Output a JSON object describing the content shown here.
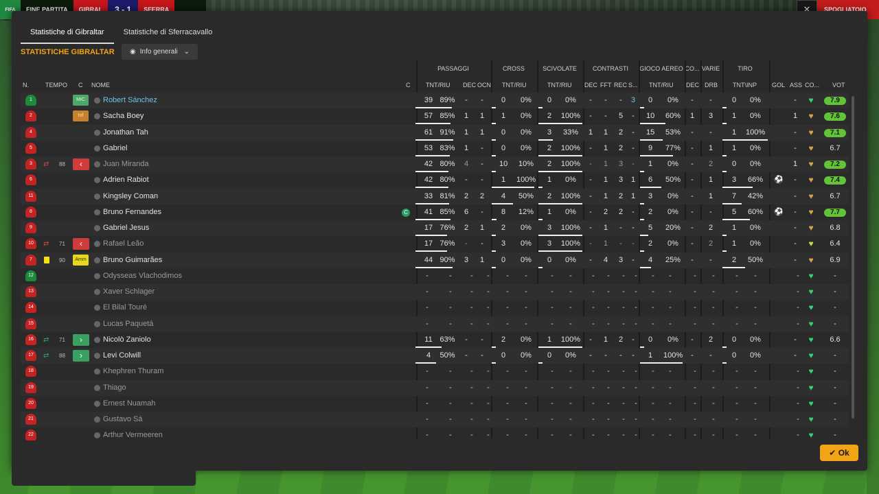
{
  "scorebar": {
    "phase": "FINE PARTITA",
    "home": "GIBRAL",
    "result": "3 - 1",
    "away": "SFERRA",
    "logo": "FIFA",
    "right_label": "SPOGLIATOIO"
  },
  "tabs": [
    {
      "label": "Statistiche di Gibraltar",
      "active": true
    },
    {
      "label": "Statistiche di Sferracavallo",
      "active": false
    }
  ],
  "title": "STATISTICHE GIBRALTAR",
  "dropdown": {
    "label": "Info generali",
    "icon": "eye-icon"
  },
  "group_headers": {
    "passaggi": "PASSAGGI",
    "cross": "CROSS",
    "scivolate": "SCIVOLATE",
    "contrasti": "CONTRASTI",
    "gioco_aereo": "GIOCO AEREO",
    "co": "CO...",
    "varie": "VARIE",
    "tiro": "TIRO"
  },
  "headers": {
    "n": "N.",
    "tempo": "TEMPO",
    "c": "C",
    "nome": "NOME",
    "cap": "C",
    "pass_tnt": "TNT/RIU",
    "pass_dec": "DEC",
    "pass_ocn": "OCN",
    "cross_tnt": "TNT/RIU",
    "sciv_tnt": "TNT/RIU",
    "con_dec": "DEC",
    "con_fft": "FFT",
    "con_rec": "REC",
    "con_s": "S...",
    "aer_tnt": "TNT/RIU",
    "co_dec": "DEC",
    "var_drb": "DRB",
    "tiro_tnt": "TNT\\INP",
    "gol": "GOL",
    "ass": "ASS",
    "co2": "CO...",
    "vot": "VOT"
  },
  "colors": {
    "accent": "#f2a417",
    "link": "#6fc3e6",
    "gk": "#1c8a3a",
    "outfield": "#c42323"
  },
  "players": [
    {
      "n": "1",
      "gk": true,
      "pos": "MIC",
      "pos_bg": "#4fa66a",
      "pos_fg": "#d9f5df",
      "name": "Robert Sánchez",
      "highlight": true,
      "sub": "",
      "swap": "",
      "mins": "",
      "card": false,
      "cap": false,
      "p": [
        "39",
        "89%",
        "-",
        "-"
      ],
      "pb": 0.89,
      "cr": [
        "0",
        "0%"
      ],
      "crb": 0,
      "sc": [
        "0",
        "0%"
      ],
      "scb": 0,
      "ct": [
        "-",
        "-",
        "-",
        "3"
      ],
      "ae": [
        "0",
        "0%"
      ],
      "aeb": 0,
      "co": "-",
      "drb": "-",
      "ti": [
        "0",
        "0%"
      ],
      "tib": 0,
      "gol": "",
      "ass": "-",
      "heart": "#35d07a",
      "vot": "7.9",
      "votbg": "#62c338"
    },
    {
      "n": "2",
      "gk": false,
      "pos": "Inf",
      "pos_bg": "#c8812f",
      "pos_fg": "#fbe2c0",
      "name": "Sacha Boey",
      "highlight": false,
      "sub": "",
      "swap": "",
      "mins": "",
      "card": false,
      "cap": false,
      "p": [
        "57",
        "85%",
        "1",
        "1"
      ],
      "pb": 0.85,
      "cr": [
        "1",
        "0%"
      ],
      "crb": 0,
      "sc": [
        "2",
        "100%"
      ],
      "scb": 1,
      "ct": [
        "-",
        "-",
        "5",
        "-"
      ],
      "ae": [
        "10",
        "60%"
      ],
      "aeb": 0.6,
      "co": "1",
      "drb": "3",
      "ti": [
        "1",
        "0%"
      ],
      "tib": 0,
      "gol": "",
      "ass": "1",
      "heart": "#d8a24a",
      "vot": "7.6",
      "votbg": "#62c338"
    },
    {
      "n": "4",
      "gk": false,
      "pos": "",
      "pos_bg": "",
      "pos_fg": "",
      "name": "Jonathan Tah",
      "highlight": false,
      "sub": "",
      "swap": "",
      "mins": "",
      "card": false,
      "cap": false,
      "p": [
        "61",
        "91%",
        "1",
        "1"
      ],
      "pb": 0.91,
      "cr": [
        "0",
        "0%"
      ],
      "crb": 0,
      "sc": [
        "3",
        "33%"
      ],
      "scb": 0.33,
      "ct": [
        "1",
        "1",
        "2",
        "-"
      ],
      "ae": [
        "15",
        "53%"
      ],
      "aeb": 0.53,
      "co": "-",
      "drb": "-",
      "ti": [
        "1",
        "100%"
      ],
      "tib": 1,
      "gol": "",
      "ass": "-",
      "heart": "#d8a24a",
      "vot": "7.1",
      "votbg": "#62c338"
    },
    {
      "n": "5",
      "gk": false,
      "pos": "",
      "pos_bg": "",
      "pos_fg": "",
      "name": "Gabriel",
      "highlight": false,
      "sub": "",
      "swap": "",
      "mins": "",
      "card": false,
      "cap": false,
      "p": [
        "53",
        "83%",
        "1",
        "-"
      ],
      "pb": 0.83,
      "cr": [
        "0",
        "0%"
      ],
      "crb": 0,
      "sc": [
        "2",
        "100%"
      ],
      "scb": 1,
      "ct": [
        "-",
        "1",
        "2",
        "-"
      ],
      "ae": [
        "9",
        "77%"
      ],
      "aeb": 0.77,
      "co": "-",
      "drb": "1",
      "ti": [
        "1",
        "0%"
      ],
      "tib": 0,
      "gol": "",
      "ass": "-",
      "heart": "#d8a24a",
      "vot": "6.7",
      "votbg": ""
    },
    {
      "n": "3",
      "gk": false,
      "pos": "out",
      "pos_bg": "",
      "pos_fg": "",
      "name": "Juan Miranda",
      "highlight": false,
      "dim": true,
      "sub": "out",
      "swap": "out",
      "mins": "88",
      "card": false,
      "cap": false,
      "p": [
        "42",
        "80%",
        "4",
        "-"
      ],
      "pb": 0.8,
      "cr": [
        "10",
        "10%"
      ],
      "crb": 0.1,
      "sc": [
        "2",
        "100%"
      ],
      "scb": 1,
      "ct": [
        "-",
        "1",
        "3",
        "-"
      ],
      "ae": [
        "1",
        "0%"
      ],
      "aeb": 0,
      "co": "-",
      "drb": "2",
      "ti": [
        "0",
        "0%"
      ],
      "tib": 0,
      "gol": "",
      "ass": "1",
      "heart": "#d8a24a",
      "vot": "7.2",
      "votbg": "#62c338"
    },
    {
      "n": "6",
      "gk": false,
      "pos": "",
      "pos_bg": "",
      "pos_fg": "",
      "name": "Adrien Rabiot",
      "highlight": false,
      "sub": "",
      "swap": "",
      "mins": "",
      "card": false,
      "cap": false,
      "p": [
        "42",
        "80%",
        "-",
        "-"
      ],
      "pb": 0.8,
      "cr": [
        "1",
        "100%"
      ],
      "crb": 1,
      "sc": [
        "1",
        "0%"
      ],
      "scb": 0,
      "ct": [
        "-",
        "1",
        "3",
        "1"
      ],
      "ae": [
        "6",
        "50%"
      ],
      "aeb": 0.5,
      "co": "-",
      "drb": "1",
      "ti": [
        "3",
        "66%"
      ],
      "tib": 0.66,
      "gol": "ball",
      "ass": "-",
      "heart": "#d8a24a",
      "vot": "7.4",
      "votbg": "#62c338"
    },
    {
      "n": "11",
      "gk": false,
      "pos": "",
      "pos_bg": "",
      "pos_fg": "",
      "name": "Kingsley Coman",
      "highlight": false,
      "sub": "",
      "swap": "",
      "mins": "",
      "card": false,
      "cap": false,
      "p": [
        "33",
        "81%",
        "2",
        "2"
      ],
      "pb": 0.81,
      "cr": [
        "4",
        "50%"
      ],
      "crb": 0.5,
      "sc": [
        "2",
        "100%"
      ],
      "scb": 1,
      "ct": [
        "-",
        "1",
        "2",
        "1"
      ],
      "ae": [
        "3",
        "0%"
      ],
      "aeb": 0,
      "co": "-",
      "drb": "1",
      "ti": [
        "7",
        "42%"
      ],
      "tib": 0.42,
      "gol": "",
      "ass": "-",
      "heart": "#d8a24a",
      "vot": "6.7",
      "votbg": ""
    },
    {
      "n": "8",
      "gk": false,
      "pos": "",
      "pos_bg": "",
      "pos_fg": "",
      "name": "Bruno Fernandes",
      "highlight": false,
      "sub": "",
      "swap": "",
      "mins": "",
      "card": false,
      "cap": true,
      "cap_label": "C",
      "p": [
        "41",
        "85%",
        "6",
        "-"
      ],
      "pb": 0.85,
      "cr": [
        "8",
        "12%"
      ],
      "crb": 0.12,
      "sc": [
        "1",
        "0%"
      ],
      "scb": 0,
      "ct": [
        "-",
        "2",
        "2",
        "-"
      ],
      "ae": [
        "2",
        "0%"
      ],
      "aeb": 0,
      "co": "-",
      "drb": "-",
      "ti": [
        "5",
        "60%"
      ],
      "tib": 0.6,
      "gol": "ball",
      "ass": "-",
      "heart": "#d8a24a",
      "vot": "7.7",
      "votbg": "#62c338"
    },
    {
      "n": "9",
      "gk": false,
      "pos": "",
      "pos_bg": "",
      "pos_fg": "",
      "name": "Gabriel Jesus",
      "highlight": false,
      "sub": "",
      "swap": "",
      "mins": "",
      "card": false,
      "cap": false,
      "p": [
        "17",
        "76%",
        "2",
        "1"
      ],
      "pb": 0.76,
      "cr": [
        "2",
        "0%"
      ],
      "crb": 0,
      "sc": [
        "3",
        "100%"
      ],
      "scb": 1,
      "ct": [
        "-",
        "1",
        "-",
        "-"
      ],
      "ae": [
        "5",
        "20%"
      ],
      "aeb": 0.2,
      "co": "-",
      "drb": "2",
      "ti": [
        "1",
        "0%"
      ],
      "tib": 0,
      "gol": "",
      "ass": "-",
      "heart": "#d8a24a",
      "vot": "6.8",
      "votbg": ""
    },
    {
      "n": "10",
      "gk": false,
      "pos": "out",
      "pos_bg": "",
      "pos_fg": "",
      "name": "Rafael Leão",
      "highlight": false,
      "dim": true,
      "sub": "out",
      "swap": "out",
      "mins": "71",
      "card": false,
      "cap": false,
      "p": [
        "17",
        "76%",
        "-",
        "-"
      ],
      "pb": 0.76,
      "cr": [
        "3",
        "0%"
      ],
      "crb": 0,
      "sc": [
        "3",
        "100%"
      ],
      "scb": 1,
      "ct": [
        "-",
        "1",
        "-",
        "-"
      ],
      "ae": [
        "2",
        "0%"
      ],
      "aeb": 0,
      "co": "-",
      "drb": "2",
      "ti": [
        "1",
        "0%"
      ],
      "tib": 0,
      "gol": "",
      "ass": "-",
      "heart": "#c8d84a",
      "vot": "6.4",
      "votbg": ""
    },
    {
      "n": "7",
      "gk": false,
      "pos": "Amm",
      "pos_bg": "#e8d81c",
      "pos_fg": "#3a3400",
      "name": "Bruno Guimarães",
      "highlight": false,
      "sub": "",
      "swap": "",
      "mins": "90",
      "card": true,
      "cap": false,
      "p": [
        "44",
        "90%",
        "3",
        "1"
      ],
      "pb": 0.9,
      "cr": [
        "0",
        "0%"
      ],
      "crb": 0,
      "sc": [
        "0",
        "0%"
      ],
      "scb": 0,
      "ct": [
        "-",
        "4",
        "3",
        "-"
      ],
      "ae": [
        "4",
        "25%"
      ],
      "aeb": 0.25,
      "co": "-",
      "drb": "-",
      "ti": [
        "2",
        "50%"
      ],
      "tib": 0.5,
      "gol": "",
      "ass": "-",
      "heart": "#d8a24a",
      "vot": "6.9",
      "votbg": ""
    },
    {
      "n": "12",
      "gk": true,
      "pos": "",
      "pos_bg": "",
      "pos_fg": "",
      "name": "Odysseas Vlachodimos",
      "highlight": false,
      "dim": true,
      "empty": true,
      "sub": "",
      "swap": "",
      "mins": "",
      "card": false,
      "cap": false,
      "heart": "#35d07a",
      "vot": "-",
      "votbg": ""
    },
    {
      "n": "13",
      "gk": false,
      "pos": "",
      "pos_bg": "",
      "pos_fg": "",
      "name": "Xaver Schlager",
      "highlight": false,
      "dim": true,
      "empty": true,
      "sub": "",
      "swap": "",
      "mins": "",
      "card": false,
      "cap": false,
      "heart": "#35d07a",
      "vot": "-",
      "votbg": ""
    },
    {
      "n": "14",
      "gk": false,
      "pos": "",
      "pos_bg": "",
      "pos_fg": "",
      "name": "El Bilal Touré",
      "highlight": false,
      "dim": true,
      "empty": true,
      "sub": "",
      "swap": "",
      "mins": "",
      "card": false,
      "cap": false,
      "heart": "#35d07a",
      "vot": "-",
      "votbg": ""
    },
    {
      "n": "15",
      "gk": false,
      "pos": "",
      "pos_bg": "",
      "pos_fg": "",
      "name": "Lucas Paquetá",
      "highlight": false,
      "dim": true,
      "empty": true,
      "sub": "",
      "swap": "",
      "mins": "",
      "card": false,
      "cap": false,
      "heart": "#35d07a",
      "vot": "-",
      "votbg": ""
    },
    {
      "n": "16",
      "gk": false,
      "pos": "in",
      "pos_bg": "",
      "pos_fg": "",
      "name": "Nicolò Zaniolo",
      "highlight": false,
      "sub": "in",
      "swap": "in",
      "mins": "71",
      "card": false,
      "cap": false,
      "p": [
        "11",
        "63%",
        "-",
        "-"
      ],
      "pb": 0.63,
      "cr": [
        "2",
        "0%"
      ],
      "crb": 0,
      "sc": [
        "1",
        "100%"
      ],
      "scb": 1,
      "ct": [
        "-",
        "1",
        "2",
        "-"
      ],
      "ae": [
        "0",
        "0%"
      ],
      "aeb": 0,
      "co": "-",
      "drb": "2",
      "ti": [
        "0",
        "0%"
      ],
      "tib": 0,
      "gol": "",
      "ass": "-",
      "heart": "#35d07a",
      "vot": "6.6",
      "votbg": ""
    },
    {
      "n": "17",
      "gk": false,
      "pos": "in",
      "pos_bg": "",
      "pos_fg": "",
      "name": "Levi Colwill",
      "highlight": false,
      "sub": "in",
      "swap": "in",
      "mins": "88",
      "card": false,
      "cap": false,
      "p": [
        "4",
        "50%",
        "-",
        "-"
      ],
      "pb": 0.5,
      "cr": [
        "0",
        "0%"
      ],
      "crb": 0,
      "sc": [
        "0",
        "0%"
      ],
      "scb": 0,
      "ct": [
        "-",
        "-",
        "-",
        "-"
      ],
      "ae": [
        "1",
        "100%"
      ],
      "aeb": 1,
      "co": "-",
      "drb": "-",
      "ti": [
        "0",
        "0%"
      ],
      "tib": 0,
      "gol": "",
      "ass": "-",
      "heart": "#35d07a",
      "vot": "-",
      "votbg": ""
    },
    {
      "n": "18",
      "gk": false,
      "pos": "",
      "pos_bg": "",
      "pos_fg": "",
      "name": "Khephren Thuram",
      "highlight": false,
      "dim": true,
      "empty": true,
      "sub": "",
      "swap": "",
      "mins": "",
      "card": false,
      "cap": false,
      "heart": "#35d07a",
      "vot": "-",
      "votbg": ""
    },
    {
      "n": "19",
      "gk": false,
      "pos": "",
      "pos_bg": "",
      "pos_fg": "",
      "name": "Thiago",
      "highlight": false,
      "dim": true,
      "empty": true,
      "sub": "",
      "swap": "",
      "mins": "",
      "card": false,
      "cap": false,
      "heart": "#35d07a",
      "vot": "-",
      "votbg": ""
    },
    {
      "n": "20",
      "gk": false,
      "pos": "",
      "pos_bg": "",
      "pos_fg": "",
      "name": "Ernest Nuamah",
      "highlight": false,
      "dim": true,
      "empty": true,
      "sub": "",
      "swap": "",
      "mins": "",
      "card": false,
      "cap": false,
      "heart": "#35d07a",
      "vot": "-",
      "votbg": ""
    },
    {
      "n": "21",
      "gk": false,
      "pos": "",
      "pos_bg": "",
      "pos_fg": "",
      "name": "Gustavo Sá",
      "highlight": false,
      "dim": true,
      "empty": true,
      "sub": "",
      "swap": "",
      "mins": "",
      "card": false,
      "cap": false,
      "heart": "#35d07a",
      "vot": "-",
      "votbg": ""
    },
    {
      "n": "22",
      "gk": false,
      "pos": "",
      "pos_bg": "",
      "pos_fg": "",
      "name": "Arthur Vermeeren",
      "highlight": false,
      "dim": true,
      "empty": true,
      "sub": "",
      "swap": "",
      "mins": "",
      "card": false,
      "cap": false,
      "heart": "#35d07a",
      "vot": "-",
      "votbg": ""
    }
  ],
  "ok_button": {
    "label": "Ok",
    "icon": "check-icon"
  }
}
